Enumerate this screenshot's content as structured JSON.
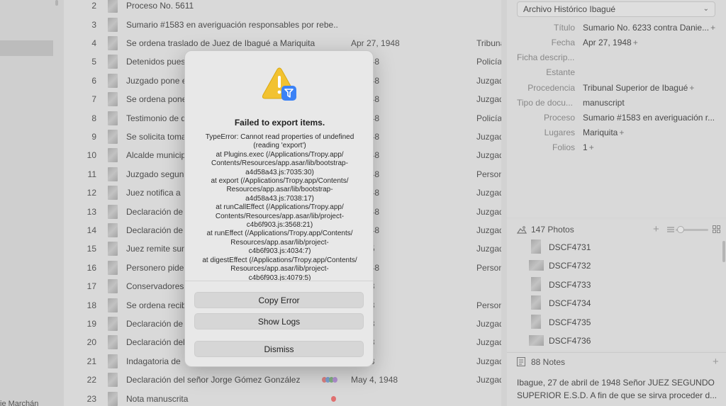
{
  "sidebar": {
    "footer_text": "ie Marchán"
  },
  "list": {
    "rows": [
      {
        "num": "2",
        "title": "Proceso No. 5611",
        "date": "",
        "source": "",
        "tags": []
      },
      {
        "num": "3",
        "title": "Sumario #1583 en averiguación responsables por rebe...",
        "date": "",
        "source": "",
        "tags": []
      },
      {
        "num": "4",
        "title": "Se ordena traslado de Juez de Ibagué a Mariquita",
        "date": "Apr 27, 1948",
        "source": "Tribunal",
        "tags": []
      },
      {
        "num": "5",
        "title": "Detenidos puestos",
        "date": "8, 1948",
        "source": "Policía",
        "tags": []
      },
      {
        "num": "6",
        "title": "Juzgado pone en",
        "date": "8, 1948",
        "source": "Juzgado",
        "tags": []
      },
      {
        "num": "7",
        "title": "Se ordena poner",
        "date": "8, 1948",
        "source": "Juzgado",
        "tags": []
      },
      {
        "num": "8",
        "title": "Testimonio de d",
        "date": "9, 1948",
        "source": "Policía",
        "tags": []
      },
      {
        "num": "9",
        "title": "Se solicita toma",
        "date": "9, 1948",
        "source": "Juzgado",
        "tags": []
      },
      {
        "num": "10",
        "title": "Alcalde municip",
        "date": "9, 1948",
        "source": "Juzgado",
        "tags": []
      },
      {
        "num": "11",
        "title": "Juzgado segun",
        "date": "0, 1948",
        "source": "Personero",
        "tags": []
      },
      {
        "num": "12",
        "title": "Juez notifica a",
        "date": "0, 1948",
        "source": "Juzgado",
        "tags": []
      },
      {
        "num": "13",
        "title": "Declaración de",
        "date": "0, 1948",
        "source": "Juzgado",
        "tags": []
      },
      {
        "num": "14",
        "title": "Declaración de",
        "date": "0, 1948",
        "source": "Juzgado",
        "tags": []
      },
      {
        "num": "15",
        "title": "Juez remite sun",
        "date": ", 1955",
        "source": "Juzgado",
        "tags": []
      },
      {
        "num": "16",
        "title": "Personero pide",
        "date": "0, 1948",
        "source": "Personero",
        "tags": []
      },
      {
        "num": "17",
        "title": "Conservadores",
        "date": ", 1948",
        "source": "",
        "tags": []
      },
      {
        "num": "18",
        "title": "Se ordena recib",
        "date": ", 1948",
        "source": "Personero",
        "tags": []
      },
      {
        "num": "19",
        "title": "Declaración de",
        "date": ", 1948",
        "source": "Juzgado",
        "tags": []
      },
      {
        "num": "20",
        "title": "Declaración del",
        "date": ", 1948",
        "source": "Juzgado",
        "tags": []
      },
      {
        "num": "21",
        "title": "Indagatoria de",
        "date": ", 1948",
        "source": "Juzgado",
        "tags": []
      },
      {
        "num": "22",
        "title": "Declaración del señor Jorge Gómez González",
        "date": "May 4, 1948",
        "source": "Juzgado",
        "tags": [
          "#d98080",
          "#7aa0d0",
          "#80b080",
          "#b08fd0"
        ]
      },
      {
        "num": "23",
        "title": "Nota manuscrita",
        "date": "",
        "source": "",
        "tags": [
          "#e07070"
        ]
      }
    ]
  },
  "metadata": {
    "template": "Archivo Histórico Ibagué",
    "fields": [
      {
        "label": "Título",
        "value": "Sumario No. 6233 contra Danie...",
        "plus": "+"
      },
      {
        "label": "Fecha",
        "value": "Apr 27, 1948",
        "plus": "+"
      },
      {
        "label": "Ficha descrip...",
        "value": "",
        "plus": ""
      },
      {
        "label": "Estante",
        "value": "",
        "plus": ""
      },
      {
        "label": "Procedencia",
        "value": "Tribunal Superior de Ibagué",
        "plus": "+"
      },
      {
        "label": "Tipo de docu...",
        "value": "manuscript",
        "plus": ""
      },
      {
        "label": "Proceso",
        "value": "Sumario #1583 en averiguación r...",
        "plus": ""
      },
      {
        "label": "Lugares",
        "value": "Mariquita",
        "plus": "+"
      },
      {
        "label": "Folios",
        "value": "1",
        "plus": "+"
      }
    ]
  },
  "photos": {
    "count_label": "147 Photos",
    "items": [
      "DSCF4731",
      "DSCF4732",
      "DSCF4733",
      "DSCF4734",
      "DSCF4735",
      "DSCF4736"
    ]
  },
  "notes": {
    "count_label": "88 Notes",
    "line1": "Ibague, 27 de abril de 1948 Señor JUEZ SEGUNDO",
    "line2": "SUPERIOR E.S.D. A fin de que se sirva proceder d..."
  },
  "dialog": {
    "title": "Failed to export items.",
    "error_lines": [
      "TypeError: Cannot read properties of undefined",
      "(reading 'export')",
      "at Plugins.exec (/Applications/Tropy.app/",
      "Contents/Resources/app.asar/lib/bootstrap-",
      "a4d58a43.js:7035:30)",
      "at export (/Applications/Tropy.app/Contents/",
      "Resources/app.asar/lib/bootstrap-",
      "a4d58a43.js:7038:17)",
      "at runCallEffect (/Applications/Tropy.app/",
      "Contents/Resources/app.asar/lib/project-",
      "c4b6f903.js:3568:21)",
      "at runEffect (/Applications/Tropy.app/Contents/",
      "Resources/app.asar/lib/project-",
      "c4b6f903.js:4034:7)",
      "at digestEffect (/Applications/Tropy.app/Contents/",
      "Resources/app.asar/lib/project-",
      "c4b6f903.js:4079:5)"
    ],
    "copy_label": "Copy Error",
    "logs_label": "Show Logs",
    "dismiss_label": "Dismiss"
  },
  "colors": {
    "warning": "#f2c230",
    "plugin_badge": "#3b82f6"
  }
}
